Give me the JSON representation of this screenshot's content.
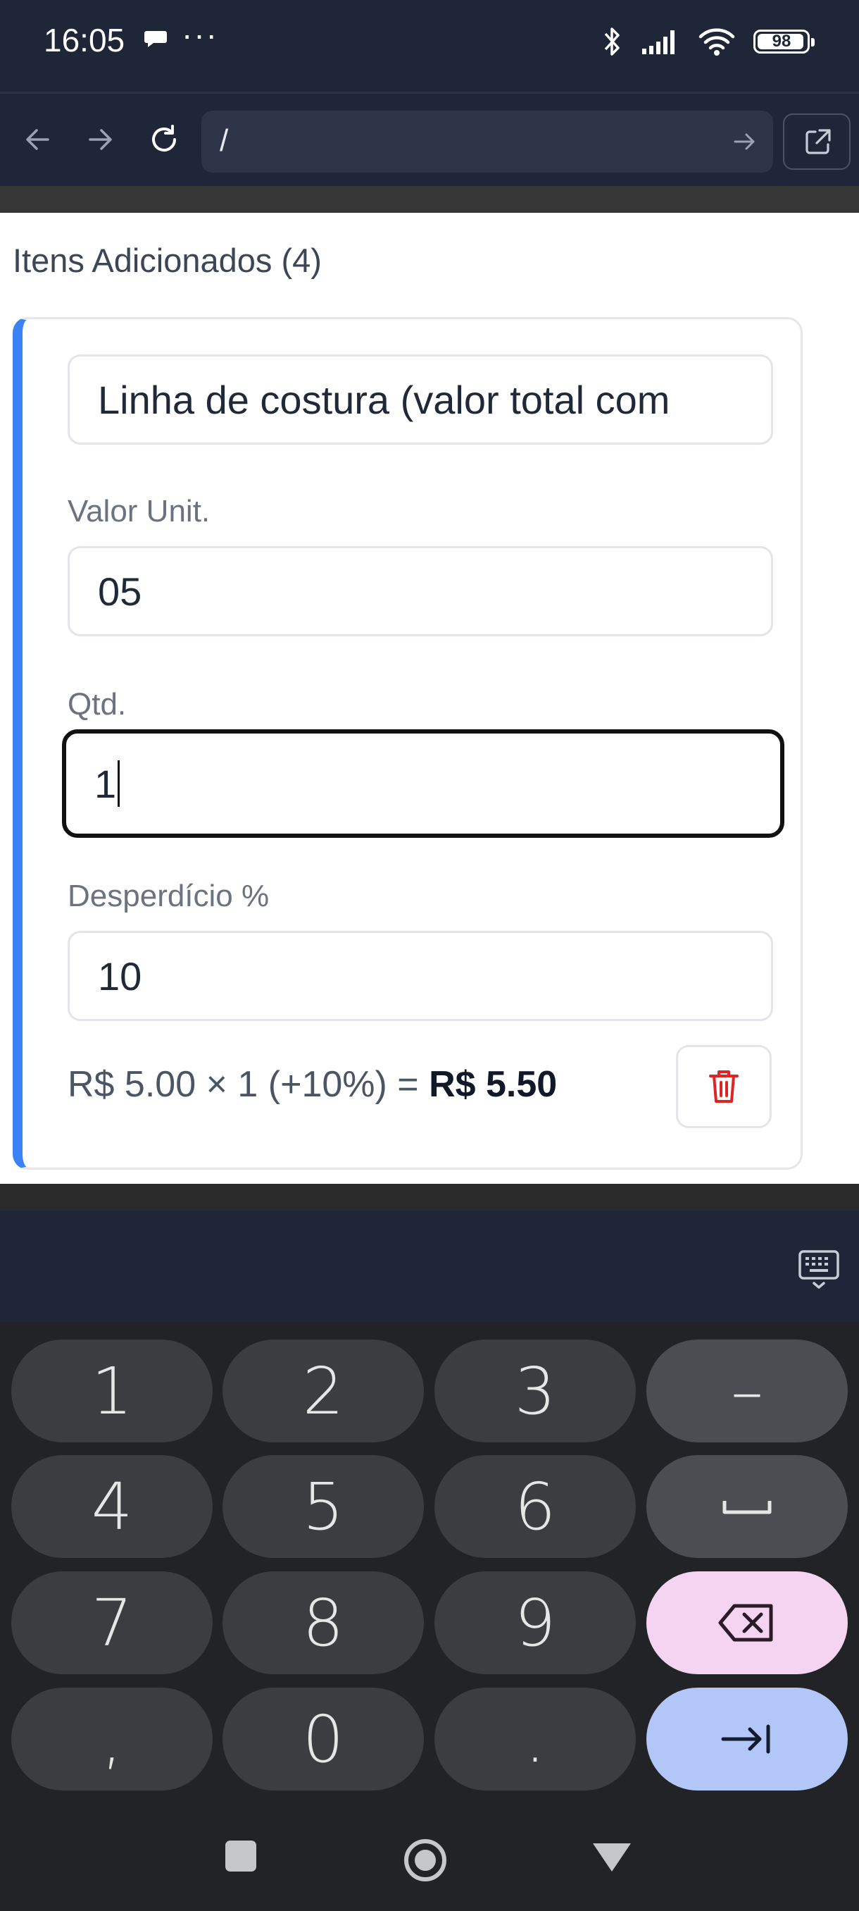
{
  "status_bar": {
    "time": "16:05",
    "more": "···",
    "battery": "98",
    "icons": [
      "chat-bubble-icon",
      "bluetooth-icon",
      "signal-icon",
      "wifi-icon",
      "battery-icon"
    ]
  },
  "browser": {
    "url": "/",
    "icons": [
      "back-arrow-icon",
      "forward-arrow-icon",
      "reload-icon",
      "go-arrow-icon",
      "open-external-icon"
    ]
  },
  "section": {
    "title": "Itens Adicionados (4)"
  },
  "item": {
    "name": "Linha de costura (valor total com",
    "unit_price_label": "Valor Unit.",
    "unit_price_value": "05",
    "qty_label": "Qtd.",
    "qty_value": "1",
    "waste_label": "Desperdício %",
    "waste_value": "10",
    "summary_formula": "R$ 5.00 × 1 (+10%) = ",
    "summary_total": "R$ 5.50",
    "accent_color": "#3b82f6",
    "delete_color": "#dc2626"
  },
  "keyboard": {
    "keys": [
      {
        "label": "1"
      },
      {
        "label": "2"
      },
      {
        "label": "3"
      },
      {
        "label": "–"
      },
      {
        "label": "4"
      },
      {
        "label": "5"
      },
      {
        "label": "6"
      },
      {
        "label": "␣"
      },
      {
        "label": "7"
      },
      {
        "label": "8"
      },
      {
        "label": "9"
      },
      {
        "label": "⌫"
      },
      {
        "label": ","
      },
      {
        "label": "0"
      },
      {
        "label": "."
      },
      {
        "label": "⇥"
      }
    ]
  }
}
